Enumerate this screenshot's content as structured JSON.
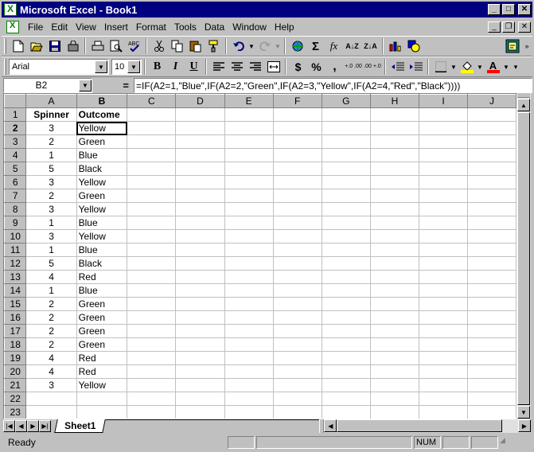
{
  "window": {
    "title": "Microsoft Excel - Book1",
    "buttons": {
      "minimize": "_",
      "maximize": "□",
      "close": "✕"
    }
  },
  "menu": {
    "items": [
      "File",
      "Edit",
      "View",
      "Insert",
      "Format",
      "Tools",
      "Data",
      "Window",
      "Help"
    ],
    "mdi_buttons": {
      "minimize": "_",
      "restore": "❐",
      "close": "✕"
    }
  },
  "toolbar_standard": {
    "autosum_label": "Σ",
    "function_label": "fx",
    "sort_asc_label": "A↓Z",
    "sort_desc_label": "Z↓A",
    "icons": [
      "new-icon",
      "open-icon",
      "save-icon",
      "permission-icon",
      "print-icon",
      "print-preview-icon",
      "spelling-icon",
      "cut-icon",
      "copy-icon",
      "paste-icon",
      "format-painter-icon",
      "undo-icon",
      "redo-icon",
      "insert-hyperlink-icon",
      "autosum-icon",
      "function-icon",
      "sort-ascending-icon",
      "sort-descending-icon",
      "chart-wizard-icon",
      "drawing-icon",
      "office-assistant-icon"
    ]
  },
  "toolbar_formatting": {
    "font_name": "Arial",
    "font_size": "10",
    "bold_label": "B",
    "italic_label": "I",
    "underline_label": "U",
    "currency_label": "$",
    "percent_label": "%",
    "comma_label": ",",
    "increase_decimal_label": "+.0 .00",
    "decrease_decimal_label": ".00 +.0",
    "font_color_label": "A",
    "colors": {
      "fill_color": "#ffff00",
      "font_color": "#ff0000"
    }
  },
  "formula_bar": {
    "name_box": "B2",
    "equals_label": "=",
    "formula": "=IF(A2=1,\"Blue\",IF(A2=2,\"Green\",IF(A2=3,\"Yellow\",IF(A2=4,\"Red\",\"Black\"))))"
  },
  "sheet": {
    "column_headers": [
      "A",
      "B",
      "C",
      "D",
      "E",
      "F",
      "G",
      "H",
      "I",
      "J"
    ],
    "active_column": "B",
    "active_row": "2",
    "rows": [
      {
        "n": "1",
        "a": "Spinner",
        "b": "Outcome"
      },
      {
        "n": "2",
        "a": "3",
        "b": "Yellow"
      },
      {
        "n": "3",
        "a": "2",
        "b": "Green"
      },
      {
        "n": "4",
        "a": "1",
        "b": "Blue"
      },
      {
        "n": "5",
        "a": "5",
        "b": "Black"
      },
      {
        "n": "6",
        "a": "3",
        "b": "Yellow"
      },
      {
        "n": "7",
        "a": "2",
        "b": "Green"
      },
      {
        "n": "8",
        "a": "3",
        "b": "Yellow"
      },
      {
        "n": "9",
        "a": "1",
        "b": "Blue"
      },
      {
        "n": "10",
        "a": "3",
        "b": "Yellow"
      },
      {
        "n": "11",
        "a": "1",
        "b": "Blue"
      },
      {
        "n": "12",
        "a": "5",
        "b": "Black"
      },
      {
        "n": "13",
        "a": "4",
        "b": "Red"
      },
      {
        "n": "14",
        "a": "1",
        "b": "Blue"
      },
      {
        "n": "15",
        "a": "2",
        "b": "Green"
      },
      {
        "n": "16",
        "a": "2",
        "b": "Green"
      },
      {
        "n": "17",
        "a": "2",
        "b": "Green"
      },
      {
        "n": "18",
        "a": "2",
        "b": "Green"
      },
      {
        "n": "19",
        "a": "4",
        "b": "Red"
      },
      {
        "n": "20",
        "a": "4",
        "b": "Red"
      },
      {
        "n": "21",
        "a": "3",
        "b": "Yellow"
      },
      {
        "n": "22",
        "a": "",
        "b": ""
      },
      {
        "n": "23",
        "a": "",
        "b": ""
      }
    ],
    "tab_name": "Sheet1"
  },
  "status": {
    "text": "Ready",
    "num_indicator": "NUM"
  }
}
